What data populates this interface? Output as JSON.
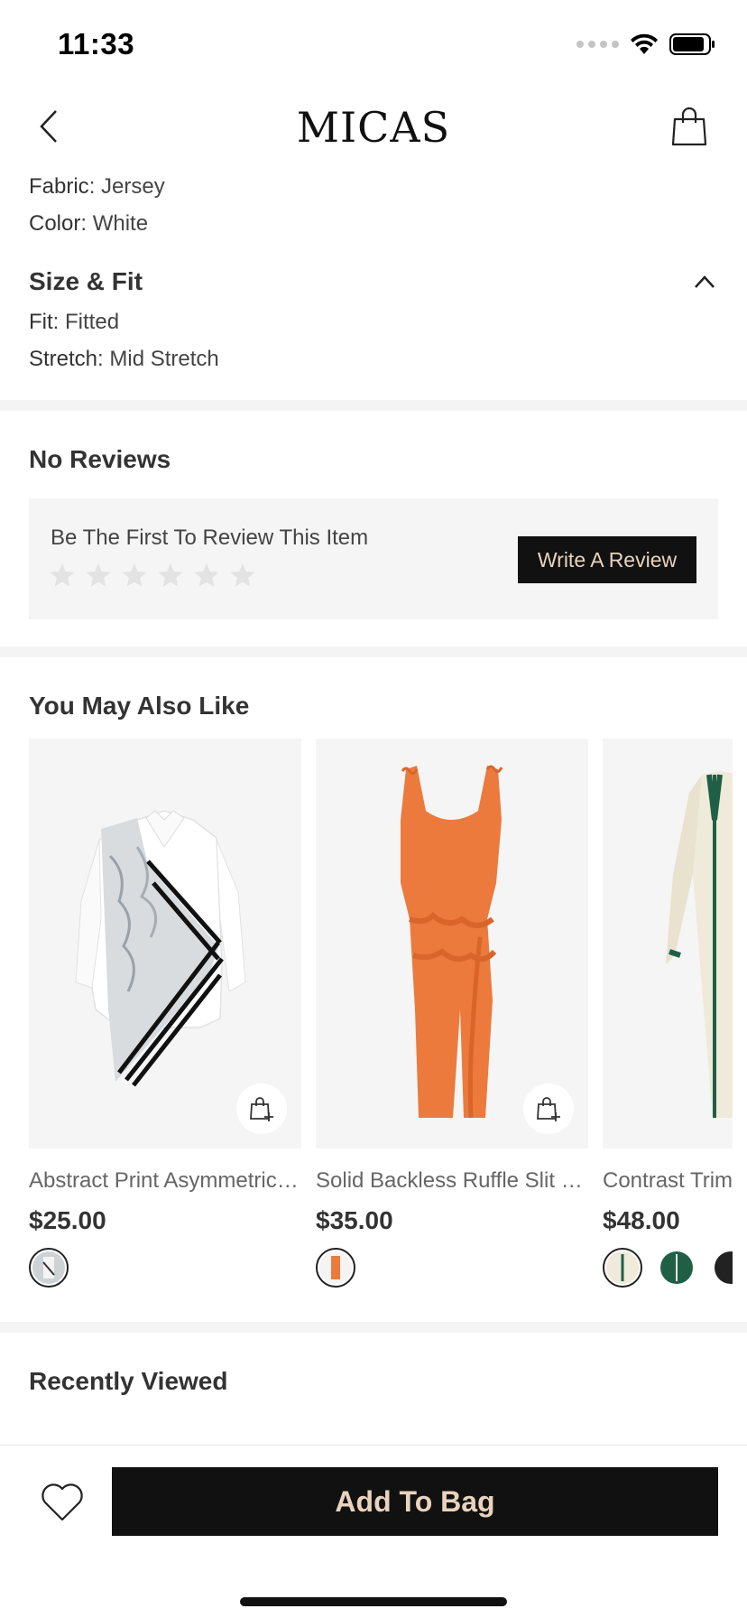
{
  "status_bar": {
    "time": "11:33"
  },
  "header": {
    "logo": "MICAS"
  },
  "details": {
    "fabric_key": "Fabric",
    "fabric_value": "Jersey",
    "color_key": "Color",
    "color_value": "White",
    "size_fit_title": "Size & Fit",
    "fit_key": "Fit",
    "fit_value": "Fitted",
    "stretch_key": "Stretch",
    "stretch_value": "Mid Stretch"
  },
  "reviews": {
    "title": "No Reviews",
    "prompt": "Be The First To Review This Item",
    "rating_stars": 6,
    "write_button": "Write A Review"
  },
  "recommendations": {
    "title": "You May Also Like",
    "items": [
      {
        "name": "Abstract Print Asymmetric Shirt",
        "price": "$25.00",
        "swatches": [
          "#cfd2d4"
        ]
      },
      {
        "name": "Solid Backless Ruffle Slit Maxi Dress",
        "price": "$35.00",
        "swatches": [
          "#ec7a3c"
        ]
      },
      {
        "name": "Contrast Trim Knit Maxi Dress",
        "price": "$48.00",
        "swatches": [
          "#efead9",
          "#1f5f47",
          "#222222"
        ]
      }
    ]
  },
  "recently_viewed": {
    "title": "Recently Viewed"
  },
  "bottom_bar": {
    "add_to_bag": "Add To Bag"
  },
  "colors": {
    "accent_text": "#e9d3bd",
    "button_bg": "#111111"
  }
}
